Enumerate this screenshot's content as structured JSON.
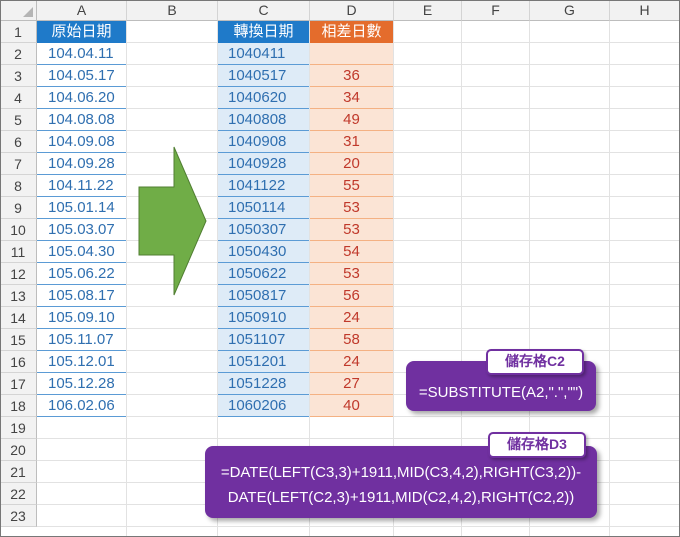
{
  "columns": [
    "A",
    "B",
    "C",
    "D",
    "E",
    "F",
    "G",
    "H"
  ],
  "rows": [
    "1",
    "2",
    "3",
    "4",
    "5",
    "6",
    "7",
    "8",
    "9",
    "10",
    "11",
    "12",
    "13",
    "14",
    "15",
    "16",
    "17",
    "18",
    "19",
    "20",
    "21",
    "22",
    "23"
  ],
  "headers": {
    "original_date": "原始日期",
    "converted_date": "轉換日期",
    "day_diff": "相差日數"
  },
  "original_dates": [
    "104.04.11",
    "104.05.17",
    "104.06.20",
    "104.08.08",
    "104.09.08",
    "104.09.28",
    "104.11.22",
    "105.01.14",
    "105.03.07",
    "105.04.30",
    "105.06.22",
    "105.08.17",
    "105.09.10",
    "105.11.07",
    "105.12.01",
    "105.12.28",
    "106.02.06"
  ],
  "converted_dates": [
    "1040411",
    "1040517",
    "1040620",
    "1040808",
    "1040908",
    "1040928",
    "1041122",
    "1050114",
    "1050307",
    "1050430",
    "1050622",
    "1050817",
    "1050910",
    "1051107",
    "1051201",
    "1051228",
    "1060206"
  ],
  "day_diffs": [
    "",
    "36",
    "34",
    "49",
    "31",
    "20",
    "55",
    "53",
    "53",
    "54",
    "53",
    "56",
    "24",
    "58",
    "24",
    "27",
    "40"
  ],
  "callout_c2": {
    "label": "儲存格C2",
    "formula": "=SUBSTITUTE(A2,\".\",\"\")"
  },
  "callout_d3": {
    "label": "儲存格D3",
    "formula_line1": "=DATE(LEFT(C3,3)+1911,MID(C3,4,2),RIGHT(C3,2))-",
    "formula_line2": "DATE(LEFT(C2,3)+1911,MID(C2,4,2),RIGHT(C2,2))"
  },
  "colors": {
    "header_blue": "#1f7ac9",
    "header_orange": "#e46c2c",
    "cell_blue": "#deebf7",
    "cell_orange": "#fbe4d5",
    "callout_purple": "#7030a0",
    "arrow_green": "#70ad47"
  }
}
